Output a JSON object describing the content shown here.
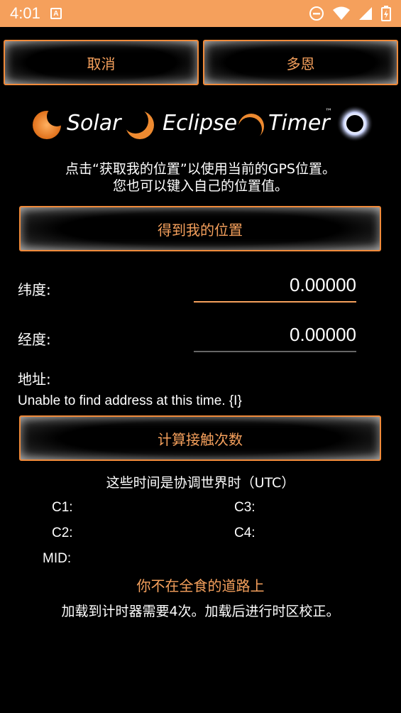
{
  "status_bar": {
    "time": "4:01",
    "left_icon": "A-icon",
    "right_icons": [
      "do-not-disturb-icon",
      "wifi-icon",
      "signal-icon",
      "battery-charging-icon"
    ]
  },
  "toolbar": {
    "cancel_label": "取消",
    "done_label": "多恩"
  },
  "logo": {
    "word1": "Solar",
    "word2": "Eclipse",
    "word3": "Timer",
    "tm": "™"
  },
  "instructions": {
    "line1": "点击“获取我的位置”以使用当前的GPS位置。",
    "line2": "您也可以键入自己的位置值。"
  },
  "location_button_label": "得到我的位置",
  "latitude": {
    "label": "纬度:",
    "value": "0.00000"
  },
  "longitude": {
    "label": "经度:",
    "value": "0.00000"
  },
  "address": {
    "label": "地址:",
    "value": "Unable to find address at this time. {I}"
  },
  "compute_button_label": "计算接触次数",
  "contacts": {
    "utc_note": "这些时间是协调世界时（UTC）",
    "c1": "C1:",
    "c2": "C2:",
    "c3": "C3:",
    "c4": "C4:",
    "mid": "MID:"
  },
  "path_warning": "你不在全食的道路上",
  "load_note": "加载到计时器需要4次。加载后进行时区校正。",
  "colors": {
    "accent": "#f5a05c",
    "border": "#f08a3a",
    "background": "#000000"
  }
}
